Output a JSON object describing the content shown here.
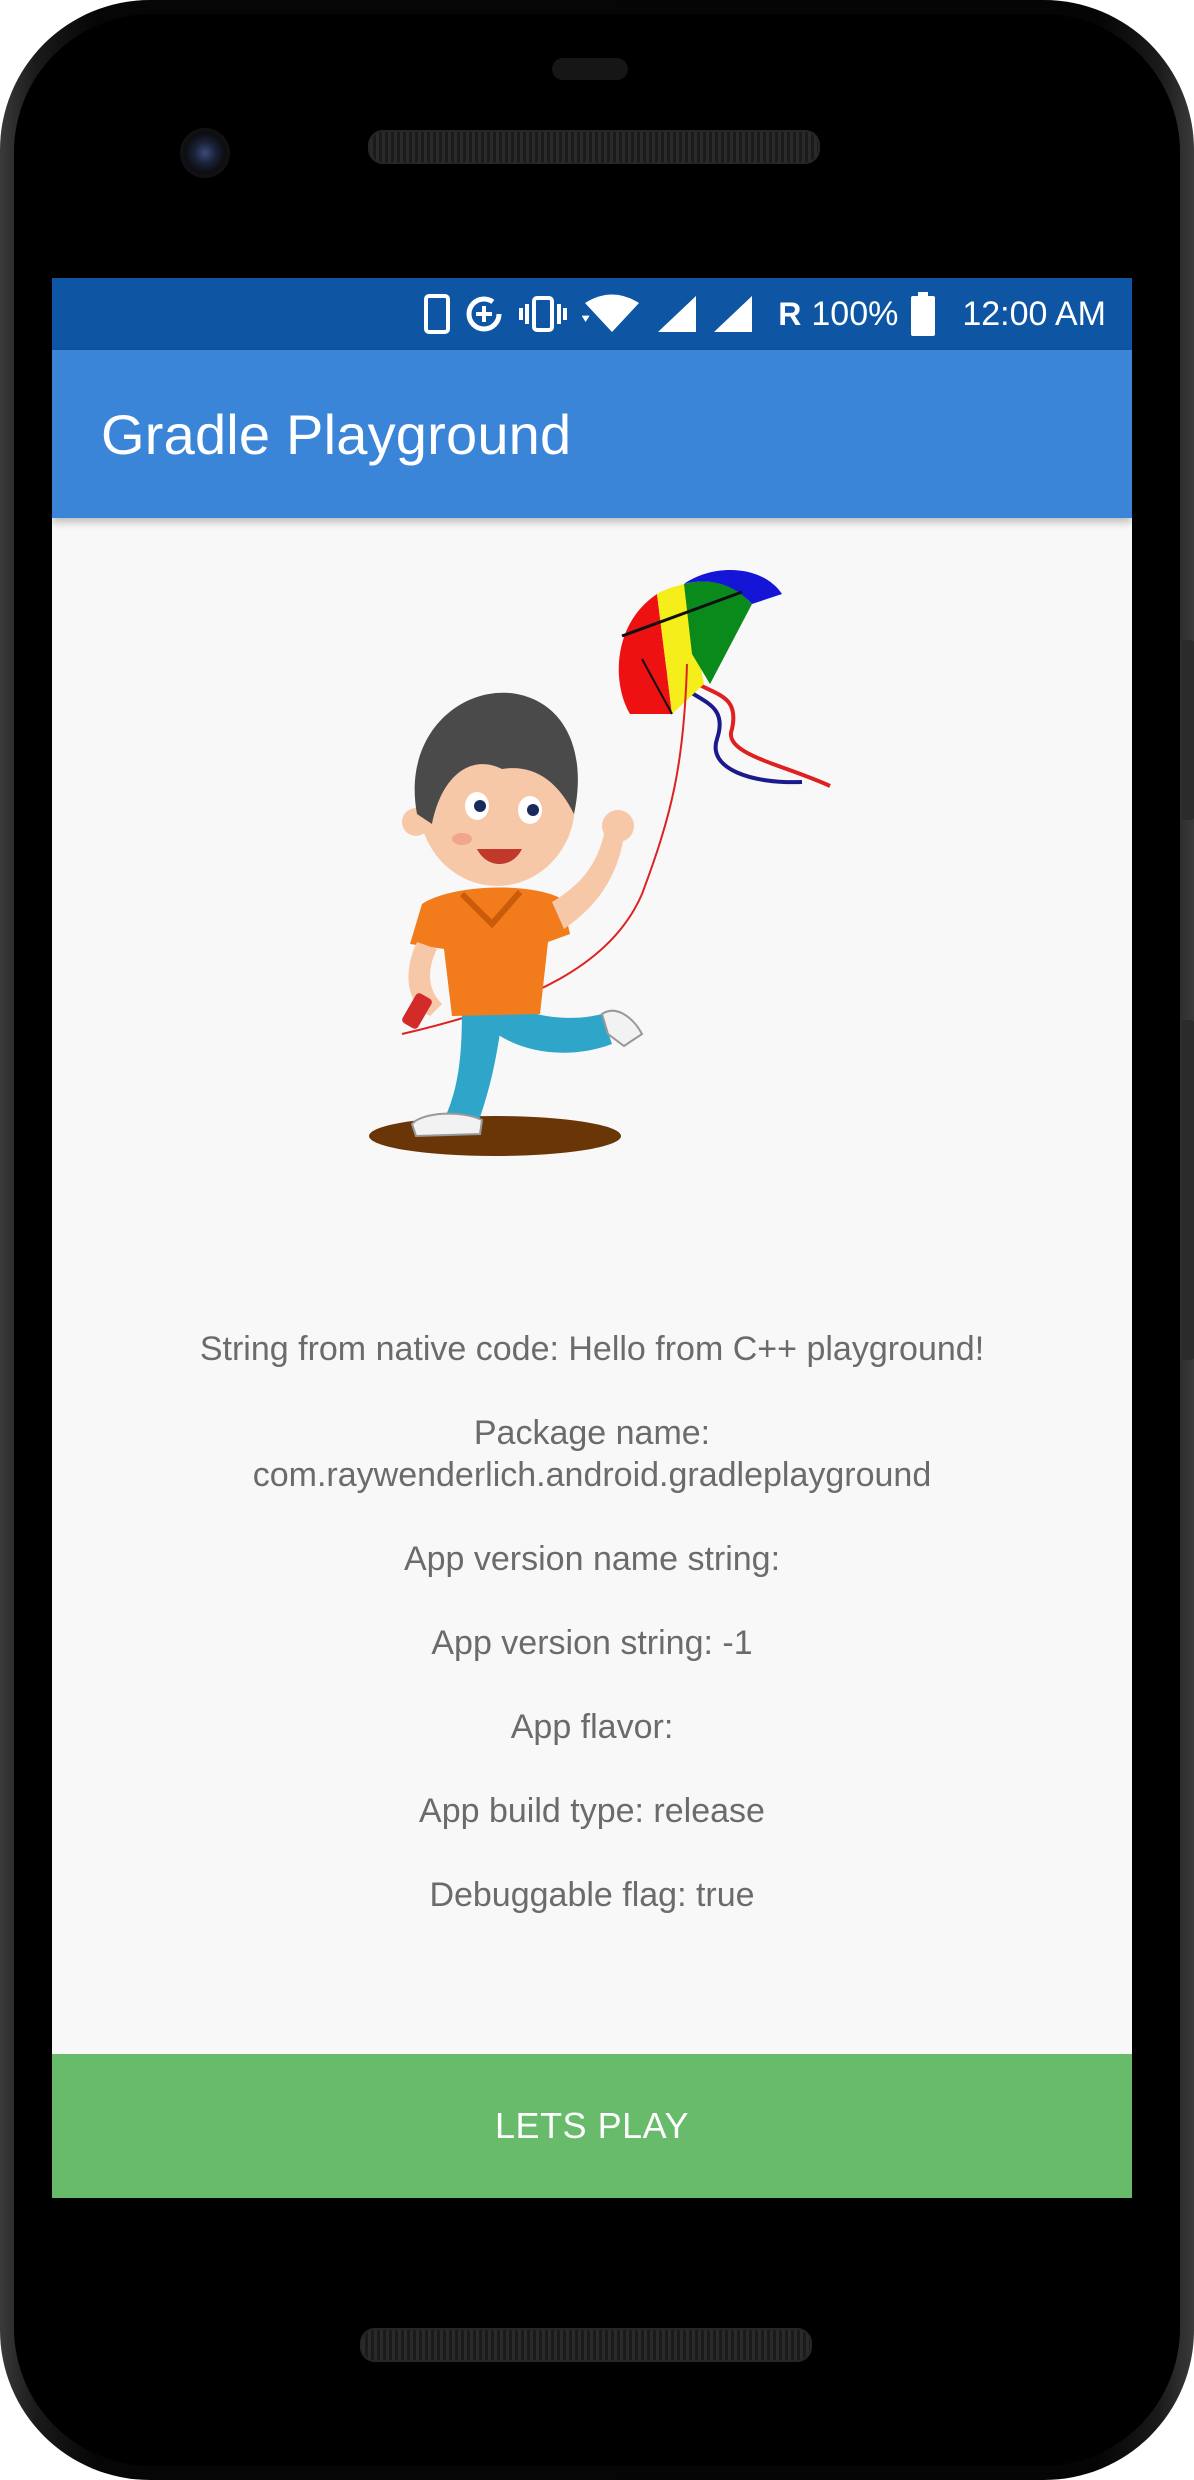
{
  "status_bar": {
    "icons": [
      "phone-icon",
      "data-saver-icon",
      "vibrate-icon",
      "wifi-icon",
      "signal-icon",
      "signal-icon"
    ],
    "roaming": "R",
    "battery": "100%",
    "time": "12:00 AM"
  },
  "app_bar": {
    "title": "Gradle Playground"
  },
  "hero": {
    "image": "kid-with-kite-illustration"
  },
  "info": {
    "native_string": "String from native code: Hello from C++ playground!",
    "package_label": "Package name:",
    "package_value": "com.raywenderlich.android.gradleplayground",
    "version_name": "App version name string:",
    "version_code": "App version string: -1",
    "flavor": "App flavor:",
    "build_type": "App build type: release",
    "debuggable": "Debuggable flag: true"
  },
  "actions": {
    "play_label": "LETS PLAY"
  },
  "colors": {
    "status_bar": "#0e56a3",
    "app_bar": "#3a85d8",
    "background": "#f8f8f8",
    "button": "#67bb6a",
    "text": "#6b6b6b"
  }
}
